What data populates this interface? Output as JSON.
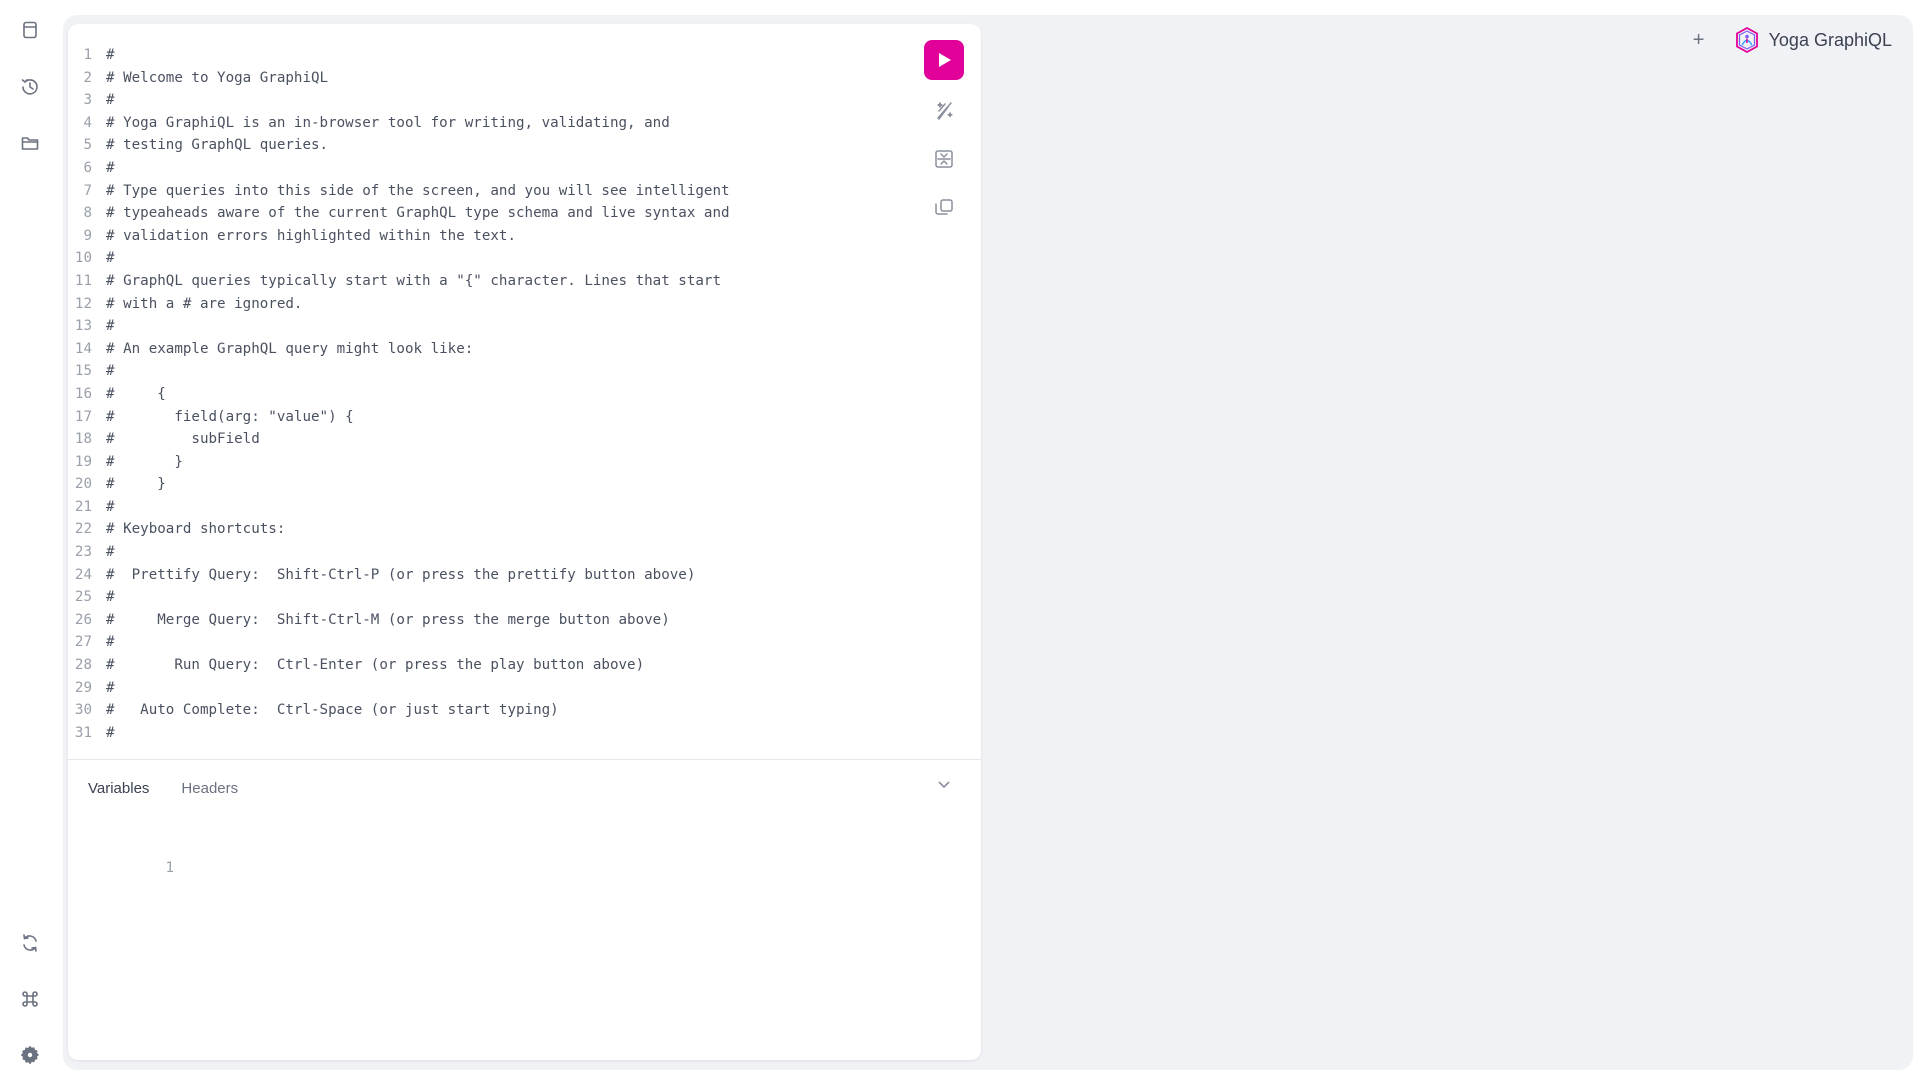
{
  "sidebar": {
    "top_icons": [
      "docs-icon",
      "history-icon",
      "explorer-icon"
    ],
    "bottom_icons": [
      "refetch-schema-icon",
      "shortcuts-icon",
      "settings-icon"
    ]
  },
  "header": {
    "add_tab_label": "+",
    "brand_name": "Yoga GraphiQL"
  },
  "editor": {
    "lines": [
      "#",
      "# Welcome to Yoga GraphiQL",
      "#",
      "# Yoga GraphiQL is an in-browser tool for writing, validating, and",
      "# testing GraphQL queries.",
      "#",
      "# Type queries into this side of the screen, and you will see intelligent",
      "# typeaheads aware of the current GraphQL type schema and live syntax and",
      "# validation errors highlighted within the text.",
      "#",
      "# GraphQL queries typically start with a \"{\" character. Lines that start",
      "# with a # are ignored.",
      "#",
      "# An example GraphQL query might look like:",
      "#",
      "#     {",
      "#       field(arg: \"value\") {",
      "#         subField",
      "#       }",
      "#     }",
      "#",
      "# Keyboard shortcuts:",
      "#",
      "#  Prettify Query:  Shift-Ctrl-P (or press the prettify button above)",
      "#",
      "#     Merge Query:  Shift-Ctrl-M (or press the merge button above)",
      "#",
      "#       Run Query:  Ctrl-Enter (or press the play button above)",
      "#",
      "#   Auto Complete:  Ctrl-Space (or just start typing)",
      "#"
    ]
  },
  "toolbar": {
    "run_icon": "play-icon",
    "prettify_icon": "prettify-icon",
    "merge_icon": "merge-icon",
    "copy_icon": "copy-icon"
  },
  "bottom_panel": {
    "tabs": [
      "Variables",
      "Headers"
    ],
    "active_tab": "Variables",
    "line_number": "1"
  },
  "colors": {
    "accent": "#e10098",
    "shell_bg": "#f1f2f5"
  }
}
